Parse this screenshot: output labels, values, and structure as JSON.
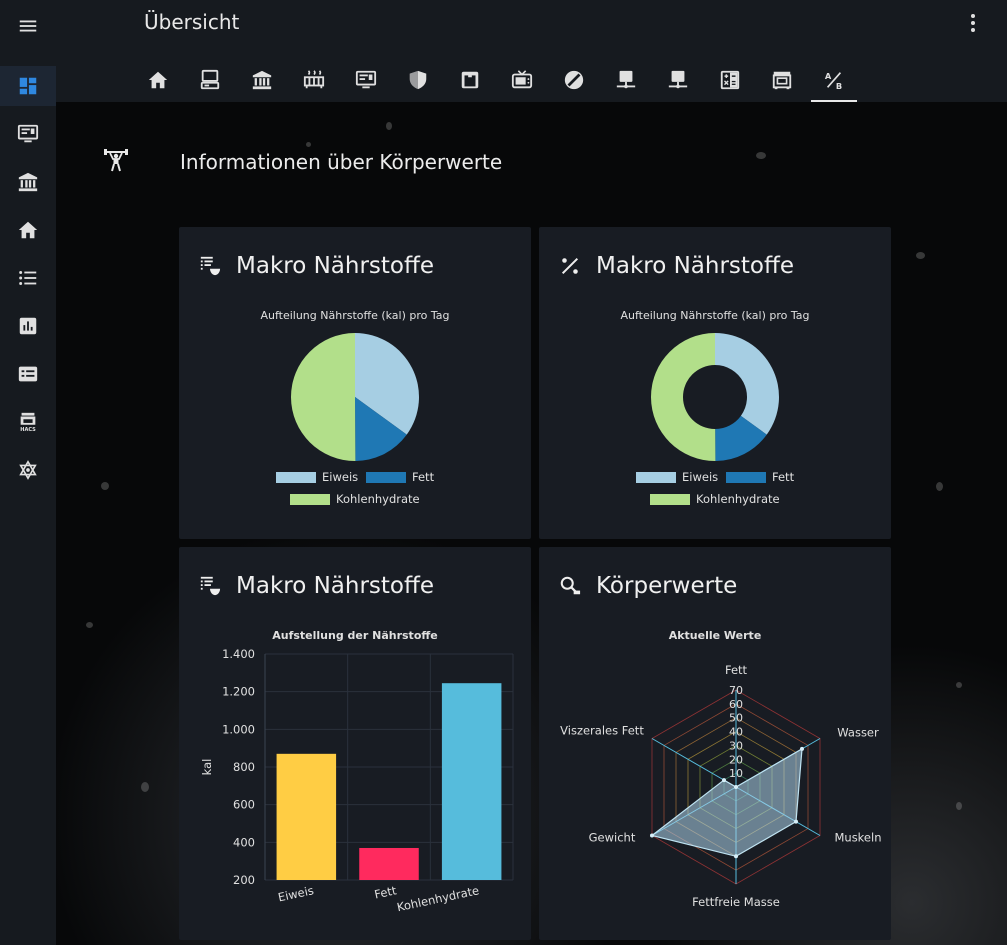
{
  "app": {
    "title": "Übersicht"
  },
  "sidebar": {
    "items": [
      {
        "icon": "menu-icon"
      },
      {
        "icon": "dashboard-icon",
        "active": true
      },
      {
        "icon": "monitor-icon"
      },
      {
        "icon": "bank-icon"
      },
      {
        "icon": "home-icon"
      },
      {
        "icon": "list-icon"
      },
      {
        "icon": "chart-icon"
      },
      {
        "icon": "card-list-icon"
      },
      {
        "icon": "hacs-icon",
        "label": "HACS"
      },
      {
        "icon": "network-icon"
      }
    ]
  },
  "tabs": [
    {
      "icon": "home-icon"
    },
    {
      "icon": "desktop-icon"
    },
    {
      "icon": "bank-icon"
    },
    {
      "icon": "radiator-icon"
    },
    {
      "icon": "monitor-icon"
    },
    {
      "icon": "shield-icon"
    },
    {
      "icon": "safe-icon"
    },
    {
      "icon": "tv-icon"
    },
    {
      "icon": "gauge-icon"
    },
    {
      "icon": "server-icon"
    },
    {
      "icon": "server-icon"
    },
    {
      "icon": "calculator-icon"
    },
    {
      "icon": "stove-icon"
    },
    {
      "icon": "ab-testing-icon",
      "active": true
    }
  ],
  "section": {
    "title": "Informationen über Körperwerte",
    "icon": "weightlifter-icon"
  },
  "cards": {
    "pie": {
      "title": "Makro Nährstoffe",
      "icon": "food-list-icon",
      "chart_title": "Aufteilung Nährstoffe (kal) pro Tag"
    },
    "doughnut": {
      "title": "Makro Nährstoffe",
      "icon": "percent-icon",
      "chart_title": "Aufteilung Nährstoffe (kal) pro Tag"
    },
    "bar": {
      "title": "Makro Nährstoffe",
      "icon": "food-list-icon",
      "chart_title": "Aufstellung der Nährstoffe"
    },
    "radar": {
      "title": "Körperwerte",
      "icon": "scale-search-icon",
      "chart_title": "Aktuelle Werte"
    }
  },
  "colors": {
    "eiweis_pie": "#a6cee3",
    "fett_pie": "#1f78b4",
    "kohlenhydrate_pie": "#b2df8a",
    "bar_eiweis": "#ffcd44",
    "bar_fett": "#ff2a5e",
    "bar_kohlenhydrate": "#56bcdc"
  },
  "chart_data": [
    {
      "type": "pie",
      "title": "Aufteilung Nährstoffe (kal) pro Tag",
      "categories": [
        "Eiweis",
        "Fett",
        "Kohlenhydrate"
      ],
      "values": [
        870,
        370,
        1245
      ],
      "legend": "bottom"
    },
    {
      "type": "doughnut",
      "title": "Aufteilung Nährstoffe (kal) pro Tag",
      "categories": [
        "Eiweis",
        "Fett",
        "Kohlenhydrate"
      ],
      "values": [
        870,
        370,
        1245
      ],
      "legend": "bottom"
    },
    {
      "type": "bar",
      "title": "Aufstellung der Nährstoffe",
      "categories": [
        "Eiweis",
        "Fett",
        "Kohlenhydrate"
      ],
      "values": [
        870,
        370,
        1245
      ],
      "ylabel": "kal",
      "ylim": [
        200,
        1400
      ],
      "yticks": [
        "200",
        "400",
        "600",
        "800",
        "1.000",
        "1.200",
        "1.400"
      ],
      "grid": true
    },
    {
      "type": "radar",
      "title": "Aktuelle Werte",
      "categories": [
        "Fett",
        "Wasser",
        "Muskeln",
        "Fettfreie Masse",
        "Gewicht",
        "Viszerales Fett"
      ],
      "values": [
        0,
        55,
        50,
        50,
        70,
        10
      ],
      "rlim": [
        0,
        70
      ],
      "ticks": [
        "10",
        "20",
        "30",
        "40",
        "50",
        "60",
        "70"
      ]
    }
  ]
}
